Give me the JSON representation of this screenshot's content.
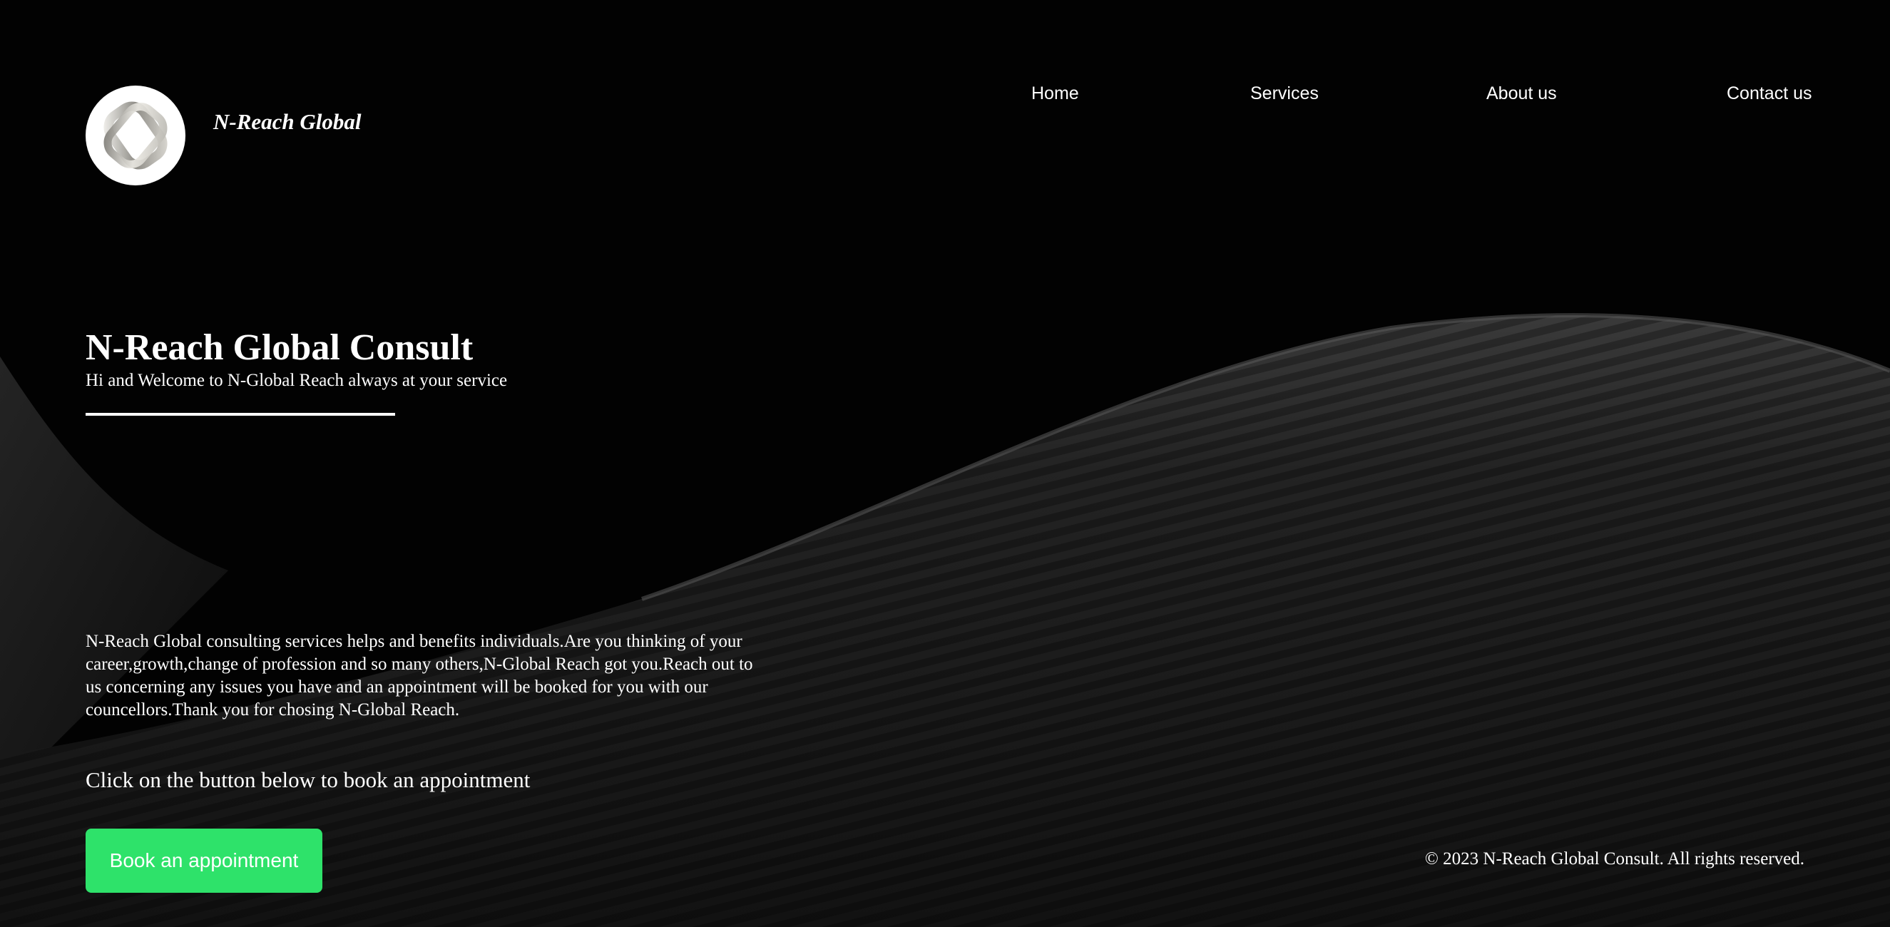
{
  "brand": {
    "name": "N-Reach Global",
    "logo_icon": "interlocked-ring-logo-icon"
  },
  "nav": {
    "items": [
      {
        "label": "Home"
      },
      {
        "label": "Services"
      },
      {
        "label": "About us"
      },
      {
        "label": "Contact us"
      }
    ]
  },
  "hero": {
    "title": "N-Reach Global Consult",
    "subtitle": "Hi and Welcome to N-Global Reach always at your service"
  },
  "intro": {
    "text": "N-Reach Global consulting services helps and benefits individuals.Are you thinking of your career,growth,change of profession and so many others,N-Global Reach got you.Reach out to us concerning any issues you have and an appointment will be booked for you with our councellors.Thank you for chosing N-Global Reach."
  },
  "cta": {
    "prompt": "Click on the button below to book an appointment",
    "button_label": "Book an appointment"
  },
  "footer": {
    "copyright": "© 2023 N-Reach Global Consult. All rights reserved."
  },
  "colors": {
    "background": "#000000",
    "accent_button": "#2ee26a",
    "text": "#ffffff"
  }
}
